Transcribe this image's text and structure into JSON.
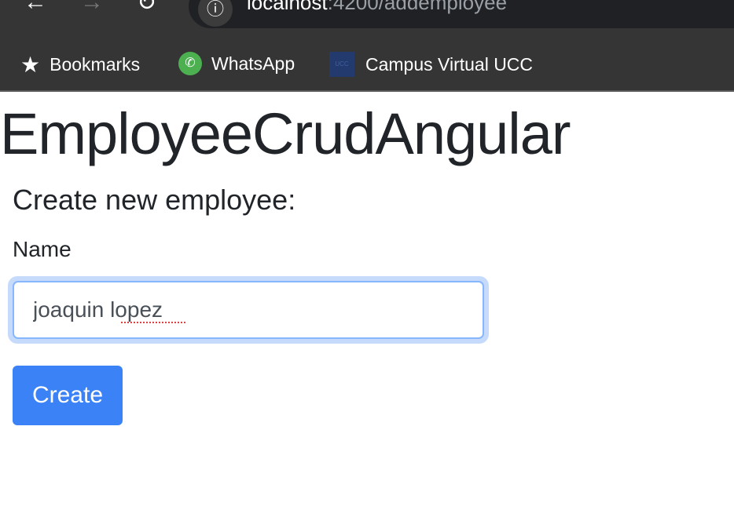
{
  "browser": {
    "url_host": "localhost",
    "url_path": ":4200/addemployee",
    "bookmarks": [
      {
        "label": "Bookmarks",
        "icon": "star-icon"
      },
      {
        "label": "WhatsApp",
        "icon": "whatsapp-icon"
      },
      {
        "label": "Campus Virtual UCC",
        "icon": "ucc-favicon",
        "favicon_text": "UCC"
      }
    ]
  },
  "page": {
    "title": "EmployeeCrudAngular",
    "subtitle": "Create new employee:",
    "name_label": "Name",
    "name_value": "joaquin lopez",
    "create_label": "Create"
  },
  "colors": {
    "primary": "#3b82f6",
    "focus_ring": "#c6dafc"
  }
}
